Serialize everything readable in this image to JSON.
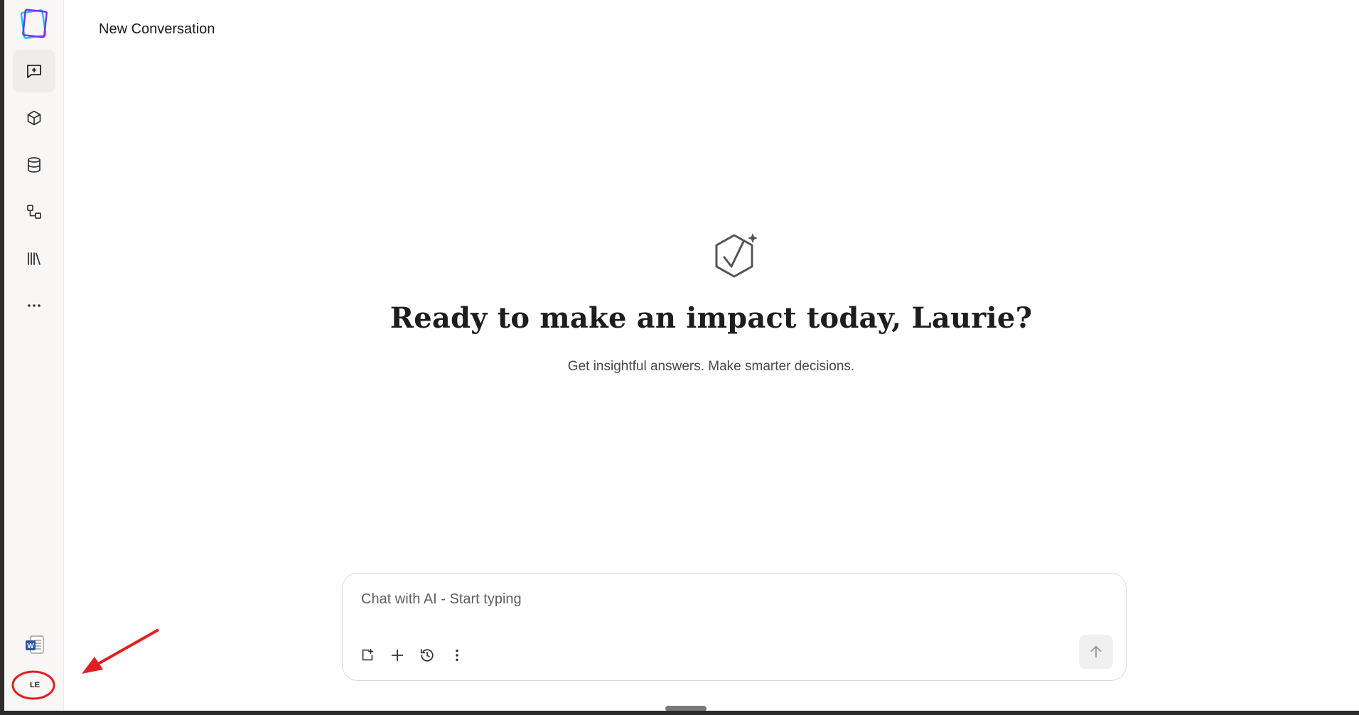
{
  "header": {
    "title": "New Conversation"
  },
  "hero": {
    "title": "Ready to make an impact today, Laurie?",
    "subtitle": "Get insightful answers. Make smarter decisions."
  },
  "composer": {
    "placeholder": "Chat with AI - Start typing",
    "tools": [
      "attach-icon",
      "plus-icon",
      "history-icon",
      "more-vertical-icon"
    ],
    "send_icon": "arrow-up-icon"
  },
  "sidebar": {
    "items": [
      {
        "icon": "new-chat-icon",
        "active": true
      },
      {
        "icon": "cube-icon",
        "active": false
      },
      {
        "icon": "database-icon",
        "active": false
      },
      {
        "icon": "workflow-icon",
        "active": false
      },
      {
        "icon": "library-icon",
        "active": false
      },
      {
        "icon": "more-horizontal-icon",
        "active": false
      }
    ],
    "word_icon": "word-icon",
    "user_initials": "LE"
  },
  "colors": {
    "annotation_red": "#e02020",
    "logo_purple": "#7b2ff7",
    "logo_cyan": "#19c6e8",
    "word_blue": "#2b579a"
  }
}
